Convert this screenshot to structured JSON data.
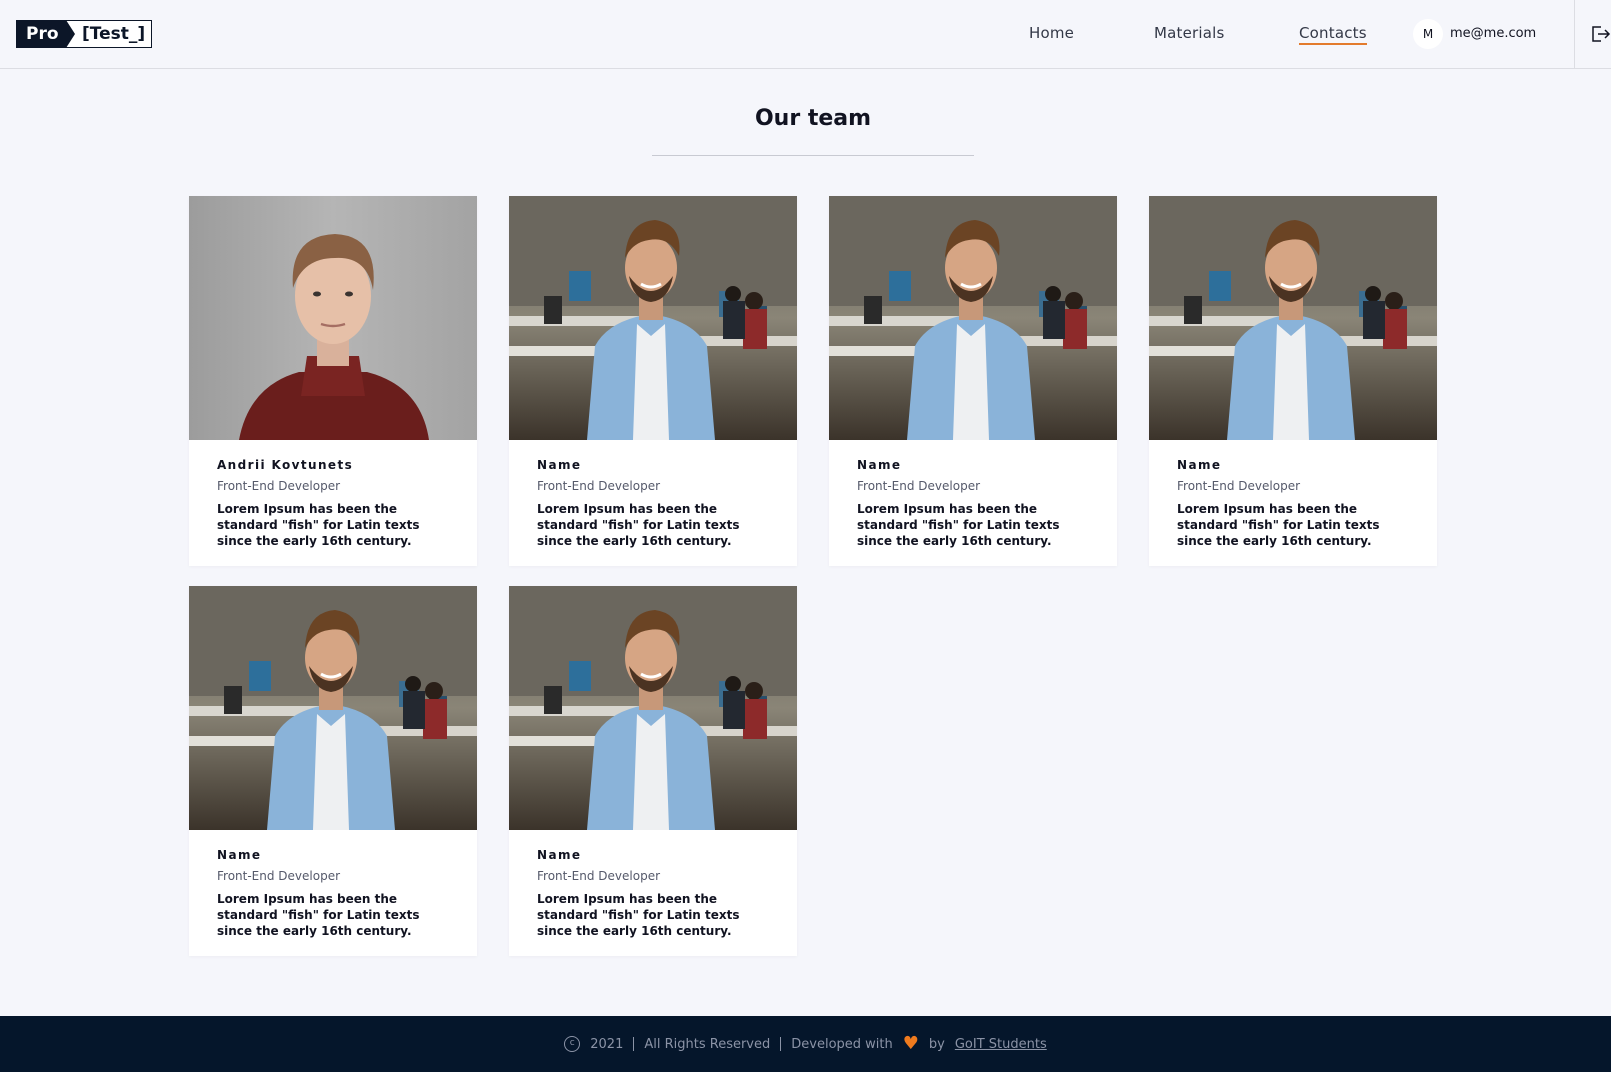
{
  "header": {
    "logo_pro": "Pro",
    "logo_test": "[Test_]",
    "nav": [
      {
        "label": "Home"
      },
      {
        "label": "Materials"
      },
      {
        "label": "Contacts",
        "active": true
      }
    ],
    "user_initial": "M",
    "user_email": "me@me.com",
    "logout_icon": "logout-icon"
  },
  "main": {
    "title": "Our team",
    "members": [
      {
        "name": "Andrii Kovtunets",
        "role": "Front-End Developer",
        "desc": "Lorem Ipsum has been the standard \"fish\" for Latin texts since the early 16th century."
      },
      {
        "name": "Name",
        "role": "Front-End Developer",
        "desc": "Lorem Ipsum has been the standard \"fish\" for Latin texts since the early 16th century."
      },
      {
        "name": "Name",
        "role": "Front-End Developer",
        "desc": "Lorem Ipsum has been the standard \"fish\" for Latin texts since the early 16th century."
      },
      {
        "name": "Name",
        "role": "Front-End Developer",
        "desc": "Lorem Ipsum has been the standard \"fish\" for Latin texts since the early 16th century."
      },
      {
        "name": "Name",
        "role": "Front-End Developer",
        "desc": "Lorem Ipsum has been the standard \"fish\" for Latin texts since the early 16th century."
      },
      {
        "name": "Name",
        "role": "Front-End Developer",
        "desc": "Lorem Ipsum has been the standard \"fish\" for Latin texts since the early 16th century."
      }
    ]
  },
  "footer": {
    "year": "2021",
    "rights": "All Rights Reserved",
    "developed": "Developed with",
    "by": "by",
    "link": "GoIT Students"
  },
  "colors": {
    "accent": "#e37b2d",
    "footer_bg": "#05162b",
    "logo_dark": "#0c1628",
    "heart": "#f07b1e"
  }
}
